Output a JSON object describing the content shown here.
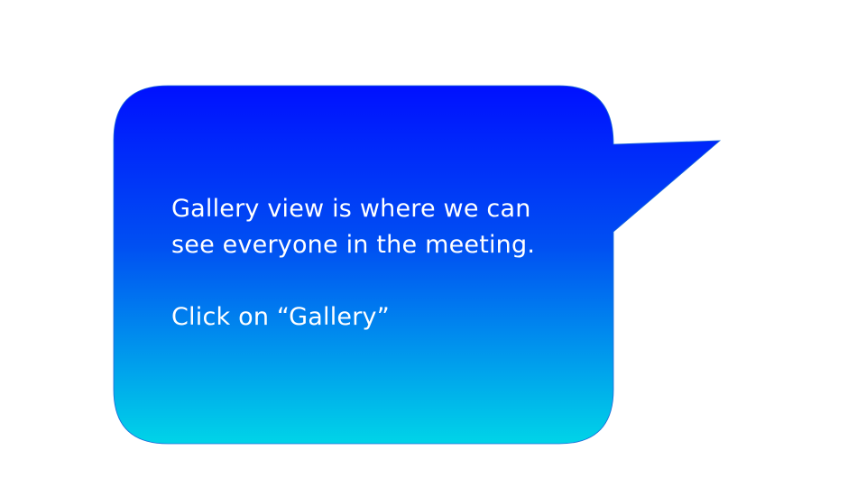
{
  "slide": {
    "background": "#ffffff"
  },
  "callout": {
    "gradient_top": "#0010ff",
    "gradient_bottom": "#00d4e8",
    "text_color": "#ffffff",
    "line_1": "Gallery view is where we can",
    "line_2": "see everyone in the meeting.",
    "instruction": "Click on “Gallery”"
  }
}
